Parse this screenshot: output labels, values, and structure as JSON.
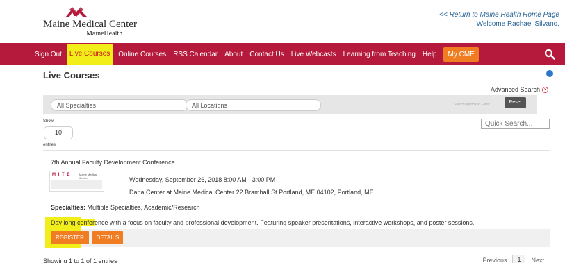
{
  "header": {
    "logo_name": "Maine Medical Center",
    "logo_sub": "MaineHealth",
    "return_link": "<< Return to Maine Health Home Page",
    "welcome": "Welcome Rachael Silvano,"
  },
  "nav": {
    "items": [
      "Sign Out",
      "Live Courses",
      "Online Courses",
      "RSS Calendar",
      "About",
      "Contact Us",
      "Live Webcasts",
      "Learning from Teaching",
      "Help",
      "My CME"
    ],
    "highlighted": "Live Courses",
    "accent": "#b5193b",
    "button_color": "#f07d22",
    "highlight_color": "#f2ee1a"
  },
  "page": {
    "title": "Live Courses",
    "advanced_search": "Advanced Search"
  },
  "filters": {
    "specialties": "All Specialties",
    "locations": "All Locations",
    "hint": "Select Options to Filter:",
    "reset": "Reset"
  },
  "table": {
    "show_label": "Show",
    "page_size": "10",
    "entries_label": "entries",
    "quick_search_placeholder": "Quick Search..."
  },
  "course": {
    "title": "7th Annual Faculty Development Conference",
    "thumb_mite": "M I T E",
    "thumb_mmc": "Maine Medical Center",
    "date": "Wednesday, September 26, 2018 8:00 AM - 3:00 PM",
    "location": "Dana Center at Maine Medical Center 22 Bramhall St Portland, ME 04102, Portland, ME",
    "specialties_label": "Specialties:",
    "specialties": "Multiple Specialties, Academic/Research",
    "desc_highlight": "Day long confer",
    "desc_rest": "ence with a focus on faculty and professional development. Featuring speaker presentations, interactive workshops, and poster sessions.",
    "register": "REGISTER",
    "details": "DETAILS"
  },
  "footer": {
    "showing": "Showing 1 to 1 of 1 entries",
    "previous": "Previous",
    "page": "1",
    "next": "Next"
  }
}
